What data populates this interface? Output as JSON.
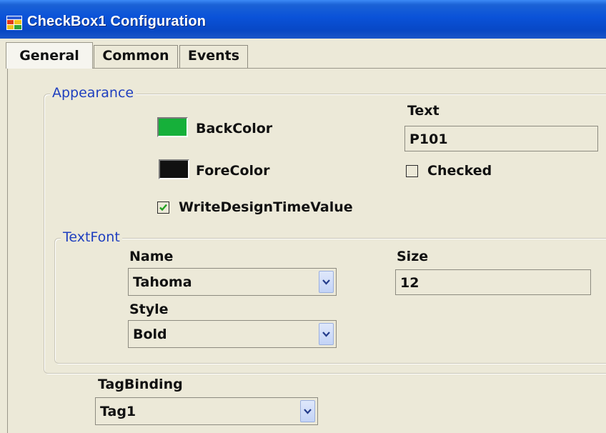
{
  "window": {
    "title": "CheckBox1 Configuration",
    "icon": "app-window-icon"
  },
  "tabs": [
    {
      "label": "General",
      "active": true
    },
    {
      "label": "Common",
      "active": false
    },
    {
      "label": "Events",
      "active": false
    }
  ],
  "appearance": {
    "legend": "Appearance",
    "backcolor": {
      "label": "BackColor",
      "color": "#16b03a"
    },
    "forecolor": {
      "label": "ForeColor",
      "color": "#111111"
    },
    "text": {
      "label": "Text",
      "value": "P101"
    },
    "checked": {
      "label": "Checked",
      "checked": false
    },
    "write_design_time_value": {
      "label": "WriteDesignTimeValue",
      "checked": true
    }
  },
  "textfont": {
    "legend": "TextFont",
    "name": {
      "label": "Name",
      "value": "Tahoma"
    },
    "size": {
      "label": "Size",
      "value": "12"
    },
    "style": {
      "label": "Style",
      "value": "Bold"
    }
  },
  "tagbinding": {
    "label": "TagBinding",
    "value": "Tag1"
  },
  "colors": {
    "titlebar": "#0a52d8",
    "legend_text": "#1f3fbf",
    "dialog_bg": "#ece9d8"
  }
}
